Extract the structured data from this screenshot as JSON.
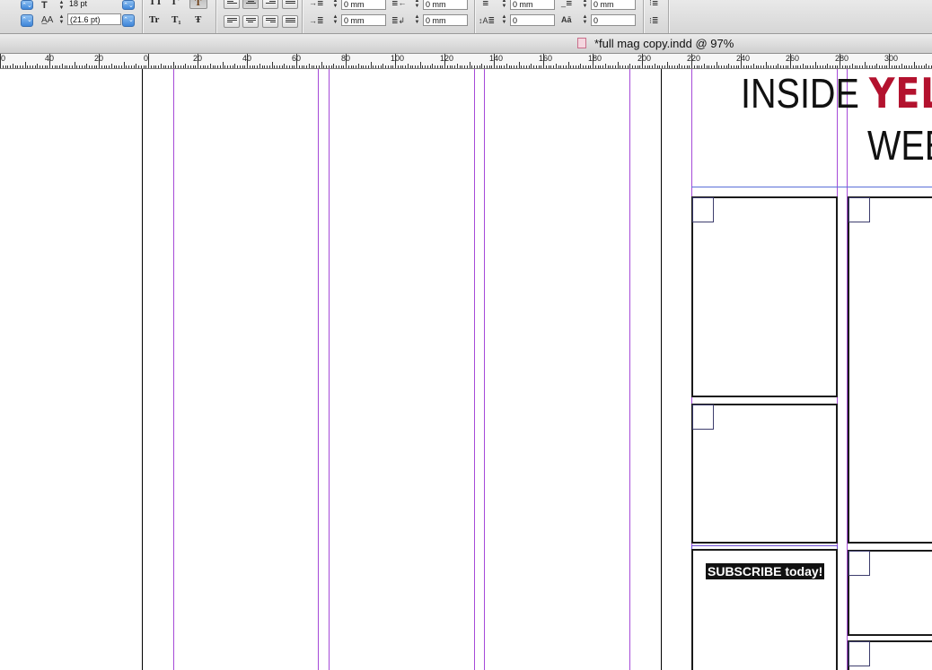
{
  "control_panel": {
    "font_size": "18 pt",
    "leading": "(21.6 pt)",
    "left_indent": "0 mm",
    "first_line_indent": "0 mm",
    "right_indent": "0 mm",
    "last_line_indent": "0 mm",
    "space_before": "0 mm",
    "space_after": "0 mm",
    "drop_cap_lines": "0",
    "drop_cap_chars": "0",
    "glyphs": {
      "all_caps": "TT",
      "superscript": "T'",
      "underline": "T",
      "small_caps": "Tr",
      "subscript": "T₁",
      "strikethrough": "Ŧ"
    }
  },
  "document": {
    "title": "*full mag copy.indd @ 97%"
  },
  "ruler": {
    "labels": [
      "0",
      "40",
      "20",
      "0",
      "20",
      "40",
      "60",
      "80",
      "100",
      "120",
      "140",
      "160",
      "180",
      "200",
      "220",
      "240",
      "260",
      "280",
      "300"
    ]
  },
  "page": {
    "heading_line1_a": "INSIDE ",
    "heading_line1_b": "YEL",
    "heading_line2": "WEE",
    "subscribe": "SUBSCRIBE today!",
    "colors": {
      "accent_red": "#b3122e",
      "guide_purple": "#8a2be2",
      "frame_edge": "#6b4bd6"
    }
  }
}
